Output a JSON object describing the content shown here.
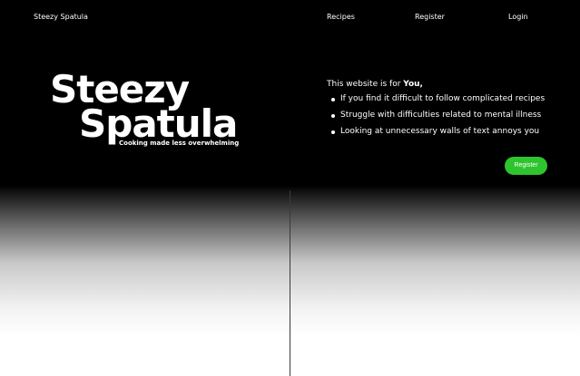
{
  "nav": {
    "brand": "Steezy Spatula",
    "links": [
      "Recipes",
      "Register",
      "Login"
    ]
  },
  "hero": {
    "title_line1": "Steezy",
    "title_line2": "Spatula",
    "tagline": "Cooking made less overwhelming"
  },
  "info": {
    "intro": "This website is for ",
    "intro_emphasis": "You,",
    "items": [
      "If you find it difficult to follow complicated recipes",
      "Struggle with difficulties related to mental illness",
      "Looking at unnecessary walls of text annoys you"
    ],
    "register_button": "Register"
  },
  "colors": {
    "background_top": "#000000",
    "background_bottom": "#ffffff",
    "accent_button": "#2ec42e",
    "text": "#ffffff"
  }
}
